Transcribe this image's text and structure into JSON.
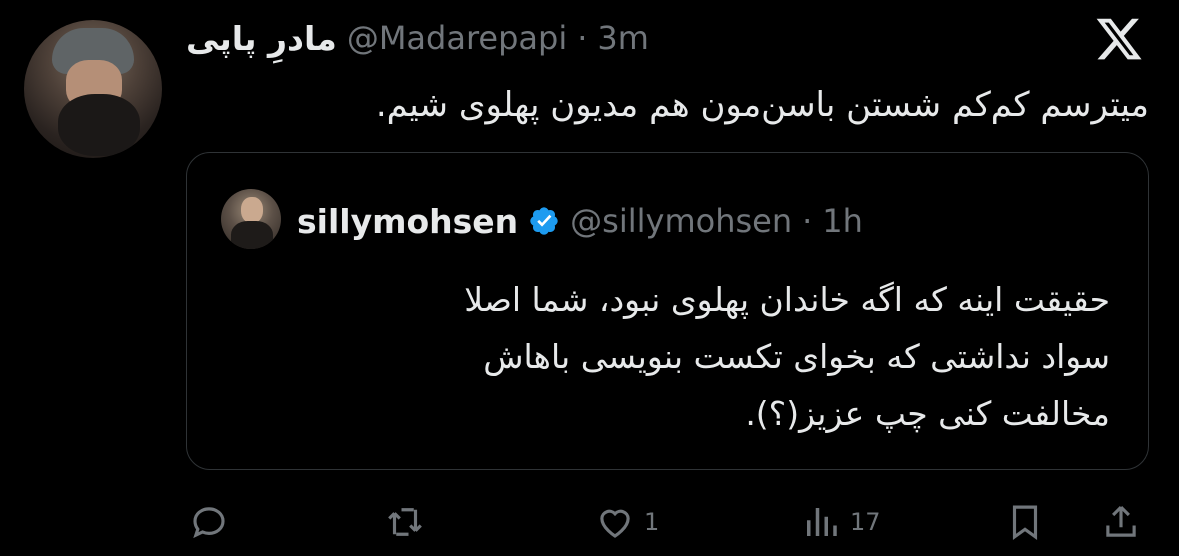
{
  "author": {
    "name": "مادرِ پاپی",
    "handle": "@Madarepapi",
    "separator": "·",
    "time": "3m"
  },
  "tweet": {
    "text": "میترسم کم‌کم شستن باسن‌مون هم مدیون پهلوی شیم."
  },
  "quoted": {
    "name": "sillymohsen",
    "handle": "@sillymohsen",
    "separator": "·",
    "time": "1h",
    "lines": [
      "حقیقت اینه که اگه خاندان پهلوی نبود، شما اصلا",
      "سواد نداشتی که بخوای تکست بنویسی باهاش",
      "مخالفت کنی چپ عزیز(؟)."
    ]
  },
  "actions": {
    "likes": "1",
    "views": "17"
  },
  "colors": {
    "background": "#000000",
    "text": "#e7e9ea",
    "muted": "#71767b",
    "border": "#2f3336",
    "verified": "#1d9bf0"
  },
  "icons": [
    "x-logo-icon",
    "verified-badge-icon",
    "reply-icon",
    "retweet-icon",
    "like-icon",
    "views-icon",
    "bookmark-icon",
    "share-icon"
  ]
}
